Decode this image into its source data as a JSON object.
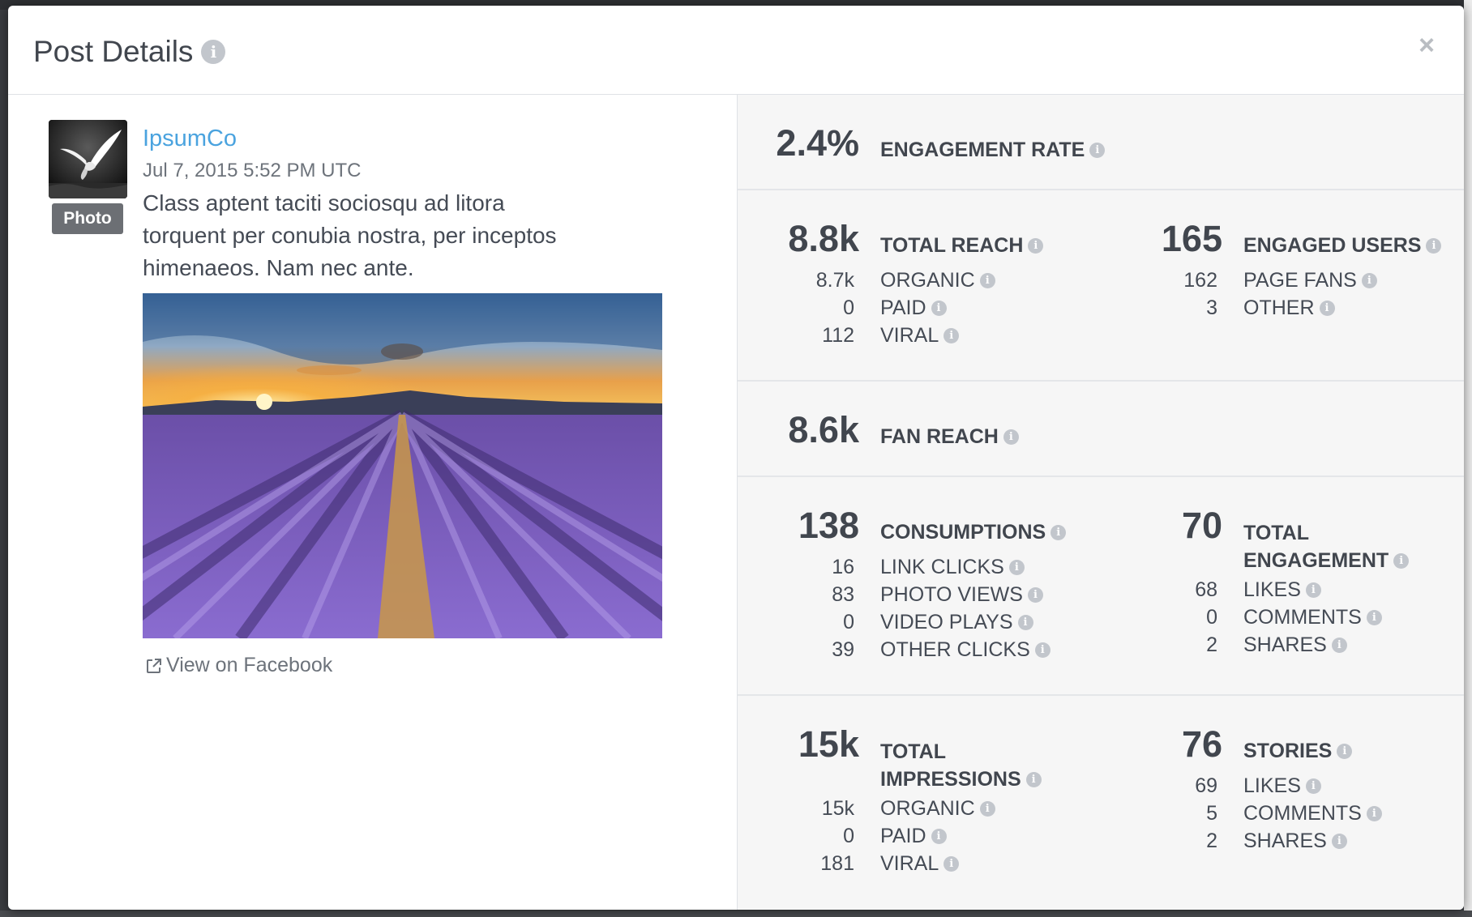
{
  "modal": {
    "title": "Post Details",
    "close_label": "×"
  },
  "post": {
    "author": "IpsumCo",
    "timestamp": "Jul 7, 2015 5:52 PM UTC",
    "type_badge": "Photo",
    "text": "Class aptent taciti sociosqu ad litora torquent per conubia nostra, per inceptos himenaeos. Nam nec ante.",
    "view_link": "View on Facebook"
  },
  "metrics": {
    "engagement_rate": {
      "value": "2.4%",
      "label": "ENGAGEMENT RATE"
    },
    "total_reach": {
      "value": "8.8k",
      "label": "TOTAL REACH",
      "rows": [
        {
          "value": "8.7k",
          "label": "ORGANIC"
        },
        {
          "value": "0",
          "label": "PAID"
        },
        {
          "value": "112",
          "label": "VIRAL"
        }
      ]
    },
    "engaged_users": {
      "value": "165",
      "label": "ENGAGED USERS",
      "rows": [
        {
          "value": "162",
          "label": "PAGE FANS"
        },
        {
          "value": "3",
          "label": "OTHER"
        }
      ]
    },
    "fan_reach": {
      "value": "8.6k",
      "label": "FAN REACH"
    },
    "consumptions": {
      "value": "138",
      "label": "CONSUMPTIONS",
      "rows": [
        {
          "value": "16",
          "label": "LINK CLICKS"
        },
        {
          "value": "83",
          "label": "PHOTO VIEWS"
        },
        {
          "value": "0",
          "label": "VIDEO PLAYS"
        },
        {
          "value": "39",
          "label": "OTHER CLICKS"
        }
      ]
    },
    "total_engagement": {
      "value": "70",
      "label_line1": "TOTAL",
      "label_line2": "ENGAGEMENT",
      "rows": [
        {
          "value": "68",
          "label": "LIKES"
        },
        {
          "value": "0",
          "label": "COMMENTS"
        },
        {
          "value": "2",
          "label": "SHARES"
        }
      ]
    },
    "total_impressions": {
      "value": "15k",
      "label_line1": "TOTAL",
      "label_line2": "IMPRESSIONS",
      "rows": [
        {
          "value": "15k",
          "label": "ORGANIC"
        },
        {
          "value": "0",
          "label": "PAID"
        },
        {
          "value": "181",
          "label": "VIRAL"
        }
      ]
    },
    "stories": {
      "value": "76",
      "label": "STORIES",
      "rows": [
        {
          "value": "69",
          "label": "LIKES"
        },
        {
          "value": "5",
          "label": "COMMENTS"
        },
        {
          "value": "2",
          "label": "SHARES"
        }
      ]
    }
  },
  "icons": {
    "info": "info-icon",
    "close": "close-icon",
    "external_link": "external-link-icon"
  },
  "colors": {
    "link": "#4aa3df",
    "heading": "#41464e",
    "info_icon": "#c2c6cc",
    "badge": "#6c6f74",
    "stats_bg": "#f6f6f6"
  }
}
